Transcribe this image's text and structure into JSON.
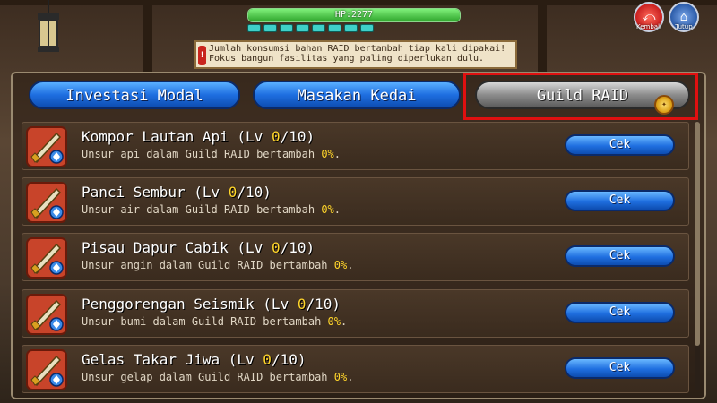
{
  "hud": {
    "hp_label": "HP:2277",
    "hp_fraction": 1.0,
    "stamina_pips": 8
  },
  "top_buttons": {
    "back_label": "Kembali",
    "close_label": "Tutup"
  },
  "notice": {
    "icon_text": "!",
    "line1": "Jumlah konsumsi bahan RAID bertambah tiap kali dipakai!",
    "line2": "Fokus bangun fasilitas yang paling diperlukan dulu."
  },
  "tabs": [
    {
      "label": "Investasi Modal",
      "active": false
    },
    {
      "label": "Masakan Kedai",
      "active": false
    },
    {
      "label": "Guild RAID",
      "active": true
    }
  ],
  "tab_badge": "✦",
  "colors": {
    "accent_blue": "#1e6ee0",
    "highlight_red": "#e01010",
    "level_yellow": "#ffd52a"
  },
  "items": [
    {
      "name": "Kompor Lautan Api",
      "lv_prefix": "(Lv ",
      "lv": "0",
      "lv_max": "/10)",
      "desc_prefix": "Unsur api dalam Guild RAID bertambah ",
      "percent": "0%",
      "desc_suffix": ".",
      "button": "Cek"
    },
    {
      "name": "Panci Sembur",
      "lv_prefix": "(Lv ",
      "lv": "0",
      "lv_max": "/10)",
      "desc_prefix": "Unsur air dalam Guild RAID bertambah ",
      "percent": "0%",
      "desc_suffix": ".",
      "button": "Cek"
    },
    {
      "name": "Pisau Dapur Cabik",
      "lv_prefix": "(Lv ",
      "lv": "0",
      "lv_max": "/10)",
      "desc_prefix": "Unsur angin dalam Guild RAID bertambah ",
      "percent": "0%",
      "desc_suffix": ".",
      "button": "Cek"
    },
    {
      "name": "Penggorengan Seismik",
      "lv_prefix": "(Lv ",
      "lv": "0",
      "lv_max": "/10)",
      "desc_prefix": "Unsur bumi dalam Guild RAID bertambah ",
      "percent": "0%",
      "desc_suffix": ".",
      "button": "Cek"
    },
    {
      "name": "Gelas Takar Jiwa",
      "lv_prefix": "(Lv ",
      "lv": "0",
      "lv_max": "/10)",
      "desc_prefix": "Unsur gelap dalam Guild RAID bertambah ",
      "percent": "0%",
      "desc_suffix": ".",
      "button": "Cek"
    }
  ]
}
